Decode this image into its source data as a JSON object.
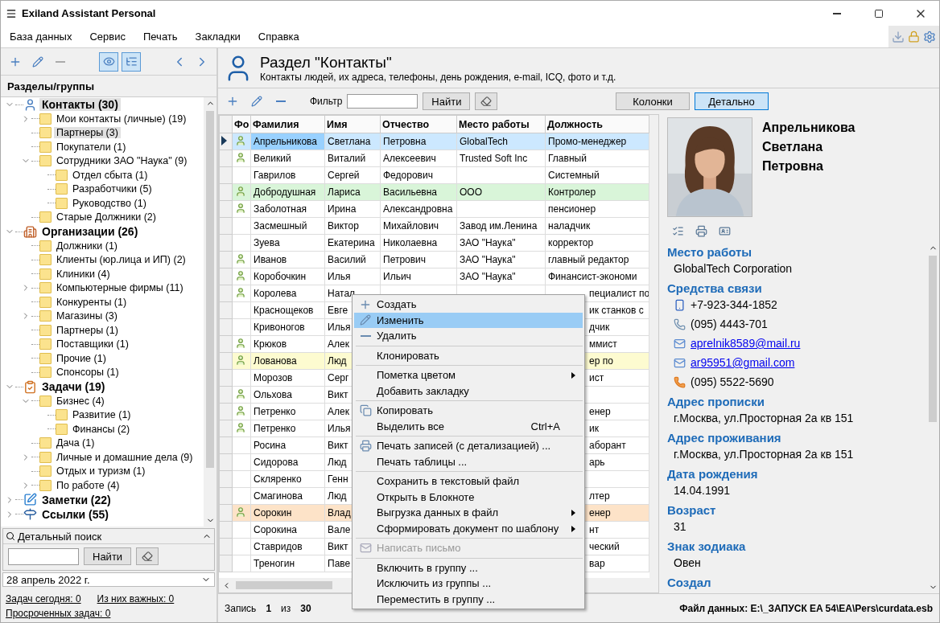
{
  "window": {
    "title": "Exiland Assistant Personal"
  },
  "menu": [
    "База данных",
    "Сервис",
    "Печать",
    "Закладки",
    "Справка"
  ],
  "sidebar": {
    "view_toggles": [
      {
        "kind": "eye",
        "selected": true
      },
      {
        "kind": "tree",
        "selected": true
      }
    ],
    "heading": "Разделы/группы",
    "tree": [
      {
        "label": "Контакты (30)",
        "kind": "contacts",
        "expanded": true,
        "selected": true,
        "children": [
          {
            "label": "Мои контакты (личные) (19)",
            "kind": "folder",
            "expanded": false,
            "selected": false
          },
          {
            "label": "Партнеры (3)",
            "kind": "folder",
            "selected": true
          },
          {
            "label": "Покупатели (1)",
            "kind": "folder",
            "selected": false
          },
          {
            "label": "Сотрудники ЗАО \"Наука\" (9)",
            "kind": "folder",
            "expanded": true,
            "selected": false,
            "children": [
              {
                "label": "Отдел сбыта (1)",
                "kind": "folder",
                "selected": false
              },
              {
                "label": "Разработчики (5)",
                "kind": "folder",
                "selected": false
              },
              {
                "label": "Руководство (1)",
                "kind": "folder",
                "selected": false
              }
            ]
          },
          {
            "label": "Старые Должники (2)",
            "kind": "folder",
            "selected": false
          }
        ]
      },
      {
        "label": "Организации (26)",
        "kind": "organizations",
        "expanded": true,
        "selected": false,
        "children": [
          {
            "label": "Должники (1)",
            "kind": "folder",
            "selected": false
          },
          {
            "label": "Клиенты (юр.лица и ИП) (2)",
            "kind": "folder",
            "selected": false
          },
          {
            "label": "Клиники (4)",
            "kind": "folder",
            "selected": false
          },
          {
            "label": "Компьютерные фирмы (11)",
            "kind": "folder",
            "expanded": false,
            "selected": false
          },
          {
            "label": "Конкуренты (1)",
            "kind": "folder",
            "selected": false
          },
          {
            "label": "Магазины (3)",
            "kind": "folder",
            "expanded": false,
            "selected": false
          },
          {
            "label": "Партнеры (1)",
            "kind": "folder",
            "selected": false
          },
          {
            "label": "Поставщики (1)",
            "kind": "folder",
            "selected": false
          },
          {
            "label": "Прочие (1)",
            "kind": "folder",
            "selected": false
          },
          {
            "label": "Спонсоры (1)",
            "kind": "folder",
            "selected": false
          }
        ]
      },
      {
        "label": "Задачи (19)",
        "kind": "tasks",
        "expanded": true,
        "selected": false,
        "children": [
          {
            "label": "Бизнес (4)",
            "kind": "folder",
            "expanded": true,
            "selected": false,
            "children": [
              {
                "label": "Развитие (1)",
                "kind": "folder",
                "selected": false
              },
              {
                "label": "Финансы (2)",
                "kind": "folder",
                "selected": false
              }
            ]
          },
          {
            "label": "Дача (1)",
            "kind": "folder",
            "selected": false
          },
          {
            "label": "Личные и домашние дела (9)",
            "kind": "folder",
            "expanded": false,
            "selected": false
          },
          {
            "label": "Отдых и туризм (1)",
            "kind": "folder",
            "selected": false
          },
          {
            "label": "По работе (4)",
            "kind": "folder",
            "expanded": false,
            "selected": false
          }
        ]
      },
      {
        "label": "Заметки (22)",
        "kind": "notes",
        "expanded": false,
        "selected": false
      },
      {
        "label": "Ссылки (55)",
        "kind": "links",
        "expanded": false,
        "selected": false
      }
    ],
    "search": {
      "title": "Детальный поиск",
      "button": "Найти"
    },
    "date": "28 апрель 2022 г.",
    "links": [
      "Задач сегодня: 0",
      "Из них важных: 0",
      "Просроченных задач: 0"
    ]
  },
  "section": {
    "title": "Раздел \"Контакты\"",
    "subtitle": "Контакты людей, их адреса, телефоны, день рождения, e-mail, ICQ, фото и т.д."
  },
  "toolbar": {
    "filter_label": "Фильтр",
    "find_button": "Найти",
    "view_buttons": [
      {
        "label": "Колонки",
        "selected": false
      },
      {
        "label": "Детально",
        "selected": true
      }
    ]
  },
  "table": {
    "columns": [
      "Фо",
      "Фамилия",
      "Имя",
      "Отчество",
      "Место работы",
      "Должность"
    ],
    "rows": [
      {
        "photo": true,
        "selected": true,
        "surname": "Апрельникова",
        "name": "Светлана",
        "patronymic": "Петровна",
        "work": "GlobalTech",
        "position": "Промо-менеджер"
      },
      {
        "photo": true,
        "selected": false,
        "surname": "Великий",
        "name": "Виталий",
        "patronymic": "Алексеевич",
        "work": "Trusted Soft Inc",
        "position": "Главный"
      },
      {
        "photo": false,
        "selected": false,
        "surname": "Гаврилов",
        "name": "Сергей",
        "patronymic": "Федорович",
        "position": "Системный"
      },
      {
        "photo": true,
        "selected": false,
        "color": "#d9f5d9",
        "surname": "Добродушная",
        "name": "Лариса",
        "patronymic": "Васильевна",
        "work": "ООО",
        "position": "Контролер"
      },
      {
        "photo": true,
        "selected": false,
        "surname": "Заболотная",
        "name": "Ирина",
        "patronymic": "Александровна",
        "position": "пенсионер"
      },
      {
        "photo": false,
        "selected": false,
        "surname": "Засмешный",
        "name": "Виктор",
        "patronymic": "Михайлович",
        "work": "Завод им.Ленина",
        "position": "наладчик"
      },
      {
        "photo": false,
        "selected": false,
        "surname": "Зуева",
        "name": "Екатерина",
        "patronymic": "Николаевна",
        "work": "ЗАО \"Наука\"",
        "position": "корректор"
      },
      {
        "photo": true,
        "selected": false,
        "surname": "Иванов",
        "name": "Василий",
        "patronymic": "Петрович",
        "work": "ЗАО \"Наука\"",
        "position": "главный редактор"
      },
      {
        "photo": true,
        "selected": false,
        "surname": "Коробочкин",
        "name": "Илья",
        "patronymic": "Ильич",
        "work": "ЗАО \"Наука\"",
        "position": "Финансист-экономи"
      },
      {
        "photo": true,
        "selected": false,
        "surname": "Королева",
        "name": "Натал",
        "position": "пециалист по"
      },
      {
        "photo": false,
        "selected": false,
        "surname": "Краснощеков",
        "name": "Евге",
        "position": "ик станков с"
      },
      {
        "photo": false,
        "selected": false,
        "surname": "Кривоногов",
        "name": "Илья",
        "position": "дчик"
      },
      {
        "photo": true,
        "selected": false,
        "surname": "Крюков",
        "name": "Алек",
        "position": "ммист"
      },
      {
        "photo": true,
        "selected": false,
        "color": "#fdfbd0",
        "surname": "Лованова",
        "name": "Люд",
        "position": "ер по"
      },
      {
        "photo": false,
        "selected": false,
        "surname": "Морозов",
        "name": "Серг",
        "position": "ист"
      },
      {
        "photo": true,
        "selected": false,
        "surname": "Ольхова",
        "name": "Викт"
      },
      {
        "photo": true,
        "selected": false,
        "surname": "Петренко",
        "name": "Алек",
        "position": "енер"
      },
      {
        "photo": true,
        "selected": false,
        "surname": "Петренко",
        "name": "Илья",
        "position": "ик"
      },
      {
        "photo": false,
        "selected": false,
        "surname": "Росина",
        "name": "Викт",
        "position": "аборант"
      },
      {
        "photo": false,
        "selected": false,
        "surname": "Сидорова",
        "name": "Люд",
        "position": "арь"
      },
      {
        "photo": false,
        "selected": false,
        "surname": "Скляренко",
        "name": "Генн"
      },
      {
        "photo": false,
        "selected": false,
        "surname": "Смагинова",
        "name": "Люд",
        "position": "лтер"
      },
      {
        "photo": true,
        "selected": false,
        "color": "#fde3c8",
        "surname": "Сорокин",
        "name": "Влад",
        "position": "енер"
      },
      {
        "photo": false,
        "selected": false,
        "surname": "Сорокина",
        "name": "Вале",
        "position": "нт"
      },
      {
        "photo": false,
        "selected": false,
        "surname": "Ставридов",
        "name": "Викт",
        "position": "ческий"
      },
      {
        "photo": false,
        "selected": false,
        "surname": "Треногин",
        "name": "Паве",
        "position": "вар"
      }
    ]
  },
  "context_menu": {
    "groups": [
      [
        {
          "label": "Создать",
          "kind": "create",
          "selected": false,
          "disabled": false,
          "submenu": false
        },
        {
          "label": "Изменить",
          "kind": "edit",
          "selected": true,
          "disabled": false,
          "submenu": false
        },
        {
          "label": "Удалить",
          "kind": "delete",
          "selected": false,
          "disabled": false,
          "submenu": false
        }
      ],
      [
        {
          "label": "Клонировать",
          "kind": "plain",
          "selected": false,
          "disabled": false,
          "submenu": false
        }
      ],
      [
        {
          "label": "Пометка цветом",
          "kind": "plain",
          "selected": false,
          "disabled": false,
          "submenu": true
        },
        {
          "label": "Добавить закладку",
          "kind": "plain",
          "selected": false,
          "disabled": false,
          "submenu": false
        }
      ],
      [
        {
          "label": "Копировать",
          "kind": "copy",
          "selected": false,
          "disabled": false,
          "submenu": false
        },
        {
          "label": "Выделить все",
          "kind": "plain",
          "selected": false,
          "disabled": false,
          "submenu": false,
          "shortcut": "Ctrl+A"
        }
      ],
      [
        {
          "label": "Печать записей (с детализацией) ...",
          "kind": "print",
          "selected": false,
          "disabled": false,
          "submenu": false
        },
        {
          "label": "Печать таблицы ...",
          "kind": "plain",
          "selected": false,
          "disabled": false,
          "submenu": false
        }
      ],
      [
        {
          "label": "Сохранить в текстовый файл",
          "kind": "plain",
          "selected": false,
          "disabled": false,
          "submenu": false
        },
        {
          "label": "Открыть в Блокноте",
          "kind": "plain",
          "selected": false,
          "disabled": false,
          "submenu": false
        },
        {
          "label": "Выгрузка данных в файл",
          "kind": "plain",
          "selected": false,
          "disabled": false,
          "submenu": true
        },
        {
          "label": "Сформировать документ по шаблону",
          "kind": "plain",
          "selected": false,
          "disabled": false,
          "submenu": true
        }
      ],
      [
        {
          "label": "Написать письмо",
          "kind": "mail",
          "selected": false,
          "disabled": true,
          "submenu": false
        }
      ],
      [
        {
          "label": "Включить в группу ...",
          "kind": "plain",
          "selected": false,
          "disabled": false,
          "submenu": false
        },
        {
          "label": "Исключить из группы ...",
          "kind": "plain",
          "selected": false,
          "disabled": false,
          "submenu": false
        },
        {
          "label": "Переместить в группу ...",
          "kind": "plain",
          "selected": false,
          "disabled": false,
          "submenu": false
        }
      ]
    ]
  },
  "details": {
    "name_lines": [
      "Апрельникова",
      "Светлана",
      "Петровна"
    ],
    "sections": [
      {
        "heading": "Место работы",
        "entries": [
          {
            "kind": "text",
            "value": "GlobalTech Corporation"
          }
        ]
      },
      {
        "heading": "Средства связи",
        "entries": [
          {
            "kind": "mobile",
            "value": "+7-923-344-1852"
          },
          {
            "kind": "phone",
            "value": "(095) 4443-701"
          },
          {
            "kind": "email",
            "value": "aprelnik8589@mail.ru"
          },
          {
            "kind": "email",
            "value": "ar95951@gmail.com"
          },
          {
            "kind": "fax",
            "value": "(095) 5522-5690"
          }
        ]
      },
      {
        "heading": "Адрес прописки",
        "entries": [
          {
            "kind": "text",
            "value": "г.Москва, ул.Просторная 2а кв 151"
          }
        ]
      },
      {
        "heading": "Адрес проживания",
        "entries": [
          {
            "kind": "text",
            "value": "г.Москва, ул.Просторная 2а кв 151"
          }
        ]
      },
      {
        "heading": "Дата рождения",
        "entries": [
          {
            "kind": "text",
            "value": "14.04.1991"
          }
        ]
      },
      {
        "heading": "Возраст",
        "entries": [
          {
            "kind": "text",
            "value": "31"
          }
        ]
      },
      {
        "heading": "Знак зодиака",
        "entries": [
          {
            "kind": "text",
            "value": "Овен"
          }
        ]
      },
      {
        "heading": "Создал"
      }
    ]
  },
  "status_bar": {
    "record_label": "Запись",
    "record": "1",
    "of": "из",
    "total": "30",
    "file": "Файл данных: E:\\_ЗАПУСК EA 54\\EA\\Pers\\curdata.esb"
  }
}
